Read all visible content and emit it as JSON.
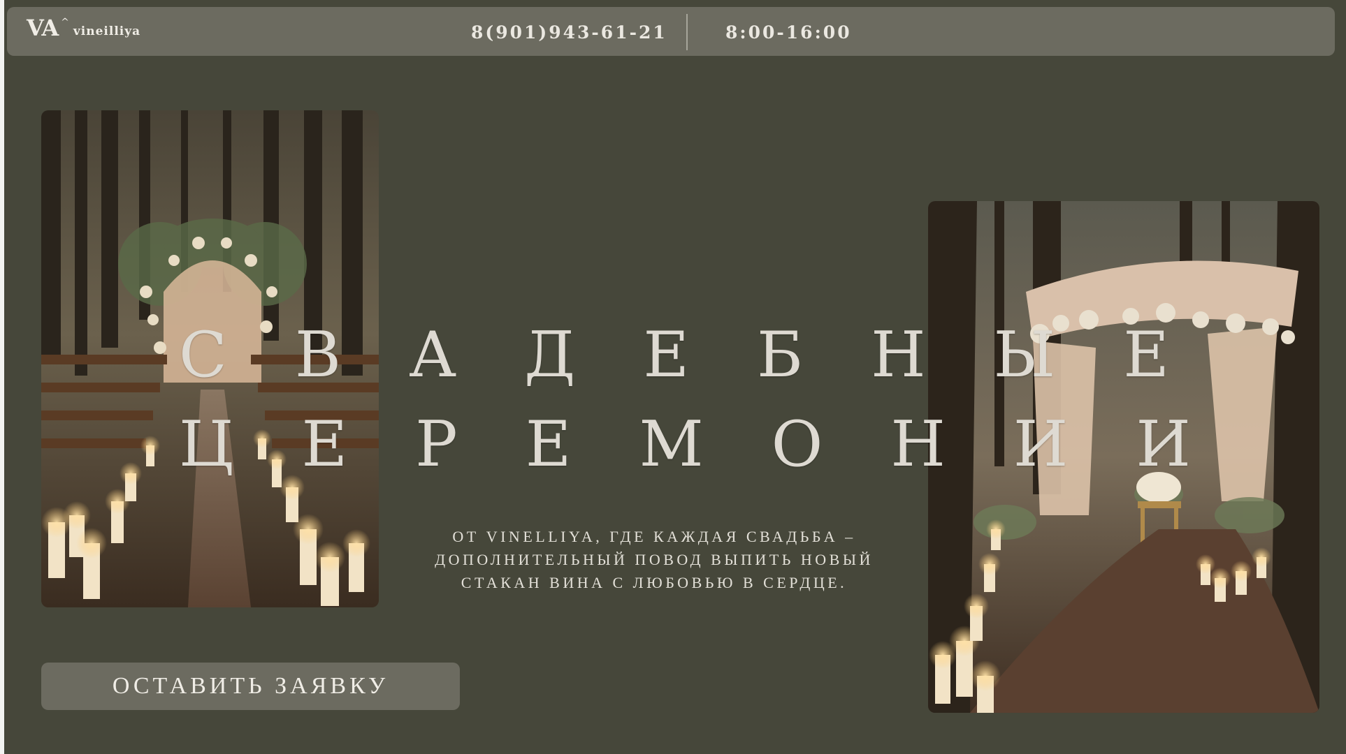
{
  "header": {
    "logo_mark": "VA",
    "logo_caret": "^",
    "logo_word": "vineilliya",
    "phone": "8(901)943-61-21",
    "hours": "8:00-16:00"
  },
  "hero": {
    "title_line1": "СВАДЕБНЫЕ",
    "title_line2": "ЦЕРЕМОНИИ",
    "subtitle_line1": "ОТ VINELLIYA, ГДЕ КАЖДАЯ СВАДЬБА –",
    "subtitle_line2": "ДОПОЛНИТЕЛЬНЫЙ ПОВОД ВЫПИТЬ НОВЫЙ",
    "subtitle_line3": "СТАКАН ВИНА С ЛЮБОВЬЮ В СЕРДЦЕ.",
    "cta_label": "ОСТАВИТЬ ЗАЯВКУ"
  },
  "images": {
    "left": "forest-ceremony-aisle-photo",
    "right": "forest-canopy-candles-photo"
  },
  "colors": {
    "background": "#46473a",
    "bar": "#6c6b60",
    "text": "#dedad2"
  }
}
